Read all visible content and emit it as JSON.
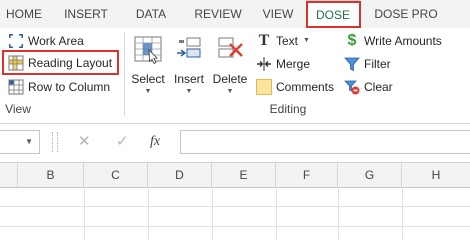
{
  "tabs": [
    "HOME",
    "INSERT",
    "DATA",
    "REVIEW",
    "VIEW",
    "DOSE",
    "DOSE PRO"
  ],
  "view_group": {
    "work_area": "Work Area",
    "reading_layout": "Reading Layout",
    "row_to_column": "Row to Column",
    "label": "View"
  },
  "editing_group": {
    "select": "Select",
    "insert": "Insert",
    "delete": "Delete",
    "text": "Text",
    "merge": "Merge",
    "comments": "Comments",
    "write_amounts": "Write Amounts",
    "filter": "Filter",
    "clear": "Clear",
    "label": "Editing"
  },
  "formula_bar": {
    "fx": "fx"
  },
  "columns": [
    "B",
    "C",
    "D",
    "E",
    "F",
    "G",
    "H"
  ],
  "colors": {
    "highlight": "#d9342b",
    "active_tab": "#217346"
  }
}
